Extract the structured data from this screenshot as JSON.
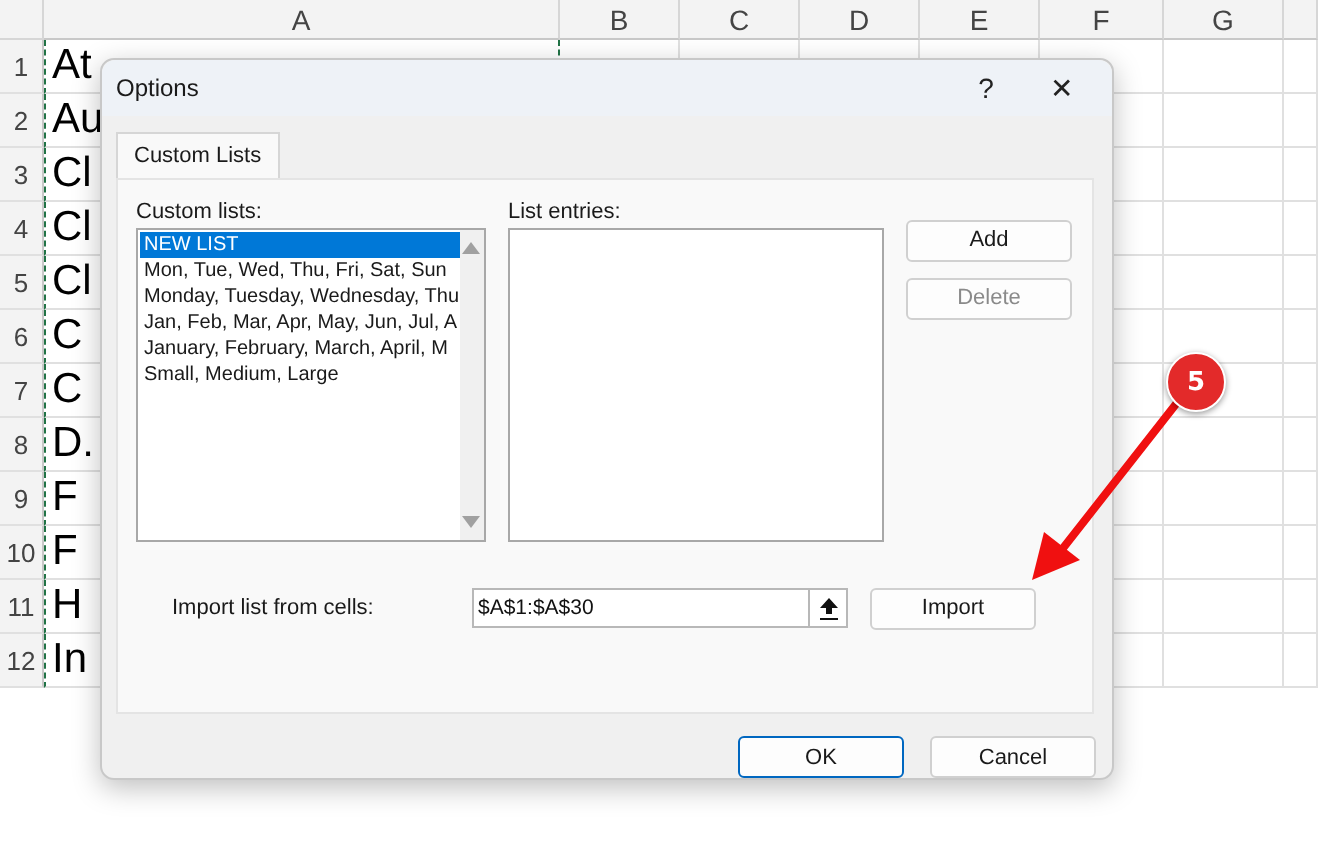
{
  "sheet": {
    "columns": [
      "A",
      "B",
      "C",
      "D",
      "E",
      "F",
      "G"
    ],
    "rows": [
      {
        "number": "1",
        "cell": "At"
      },
      {
        "number": "2",
        "cell": "Au"
      },
      {
        "number": "3",
        "cell": "Cl"
      },
      {
        "number": "4",
        "cell": "Cl"
      },
      {
        "number": "5",
        "cell": "Cl"
      },
      {
        "number": "6",
        "cell": "C"
      },
      {
        "number": "7",
        "cell": "C"
      },
      {
        "number": "8",
        "cell": "D."
      },
      {
        "number": "9",
        "cell": "F"
      },
      {
        "number": "10",
        "cell": "F"
      },
      {
        "number": "11",
        "cell": "H"
      },
      {
        "number": "12",
        "cell": "In"
      }
    ]
  },
  "dialog": {
    "title": "Options",
    "help": "?",
    "close": "✕",
    "tabs": [
      {
        "label": "Custom Lists",
        "selected": true
      }
    ],
    "custom_lists": {
      "label": "Custom lists:",
      "items": [
        {
          "text": "NEW LIST",
          "selected": true
        },
        {
          "text": "Mon, Tue, Wed, Thu, Fri, Sat, Sun",
          "selected": false
        },
        {
          "text": "Monday, Tuesday, Wednesday, Thu",
          "selected": false
        },
        {
          "text": "Jan, Feb, Mar, Apr, May, Jun, Jul, A",
          "selected": false
        },
        {
          "text": "January, February, March, April, M",
          "selected": false
        },
        {
          "text": "Small, Medium, Large",
          "selected": false
        }
      ]
    },
    "list_entries": {
      "label": "List entries:"
    },
    "side_buttons": [
      {
        "label": "Add",
        "disabled": false
      },
      {
        "label": "Delete",
        "disabled": true
      }
    ],
    "import": {
      "label": "Import list from cells:",
      "value": "$A$1:$A$30",
      "button": "Import"
    },
    "footer_buttons": [
      {
        "label": "OK",
        "default": true
      },
      {
        "label": "Cancel",
        "default": false
      }
    ]
  },
  "callout": {
    "text": "5"
  }
}
